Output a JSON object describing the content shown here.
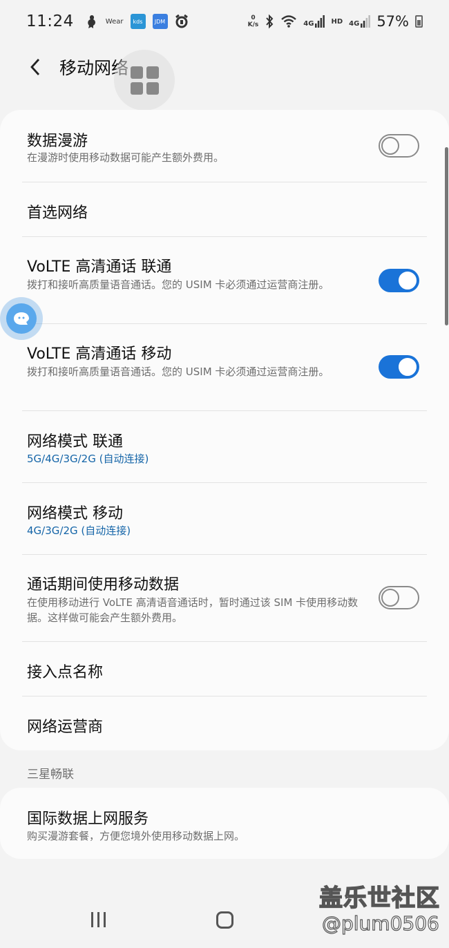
{
  "status_bar": {
    "time": "11:24",
    "wear_label": "Wear",
    "app_icon_1": "kds",
    "app_icon_2": "JDM",
    "net_speed_value": "0",
    "net_speed_unit": "K/s",
    "signal_label_1": "4G",
    "hd_label": "HD",
    "signal_label_2": "4G",
    "battery_percent": "57%"
  },
  "header": {
    "title": "移动网络"
  },
  "settings": [
    {
      "title": "数据漫游",
      "subtitle": "在漫游时使用移动数据可能产生额外费用。",
      "toggle": false
    },
    {
      "title": "首选网络"
    },
    {
      "title": "VoLTE 高清通话 联通",
      "subtitle": "拨打和接听高质量语音通话。您的 USIM 卡必须通过运营商注册。",
      "toggle": true
    },
    {
      "title": "VoLTE 高清通话 移动",
      "subtitle": "拨打和接听高质量语音通话。您的 USIM 卡必须通过运营商注册。",
      "toggle": true
    },
    {
      "title": "网络模式 联通",
      "subtitle": "5G/4G/3G/2G (自动连接)"
    },
    {
      "title": "网络模式 移动",
      "subtitle": "4G/3G/2G (自动连接)"
    },
    {
      "title": "通话期间使用移动数据",
      "subtitle": "在使用移动进行 VoLTE 高清语音通话时，暂时通过该 SIM 卡使用移动数据。这样做可能会产生额外费用。",
      "toggle": false
    },
    {
      "title": "接入点名称"
    },
    {
      "title": "网络运营商"
    }
  ],
  "section_samsung": {
    "header": "三星畅联",
    "item": {
      "title": "国际数据上网服务",
      "subtitle": "购买漫游套餐，方便您境外使用移动数据上网。"
    }
  },
  "watermark": {
    "title": "盖乐世社区",
    "user": "@plum0506"
  },
  "colors": {
    "accent": "#1a73d8",
    "link_blue": "#1565a8"
  }
}
